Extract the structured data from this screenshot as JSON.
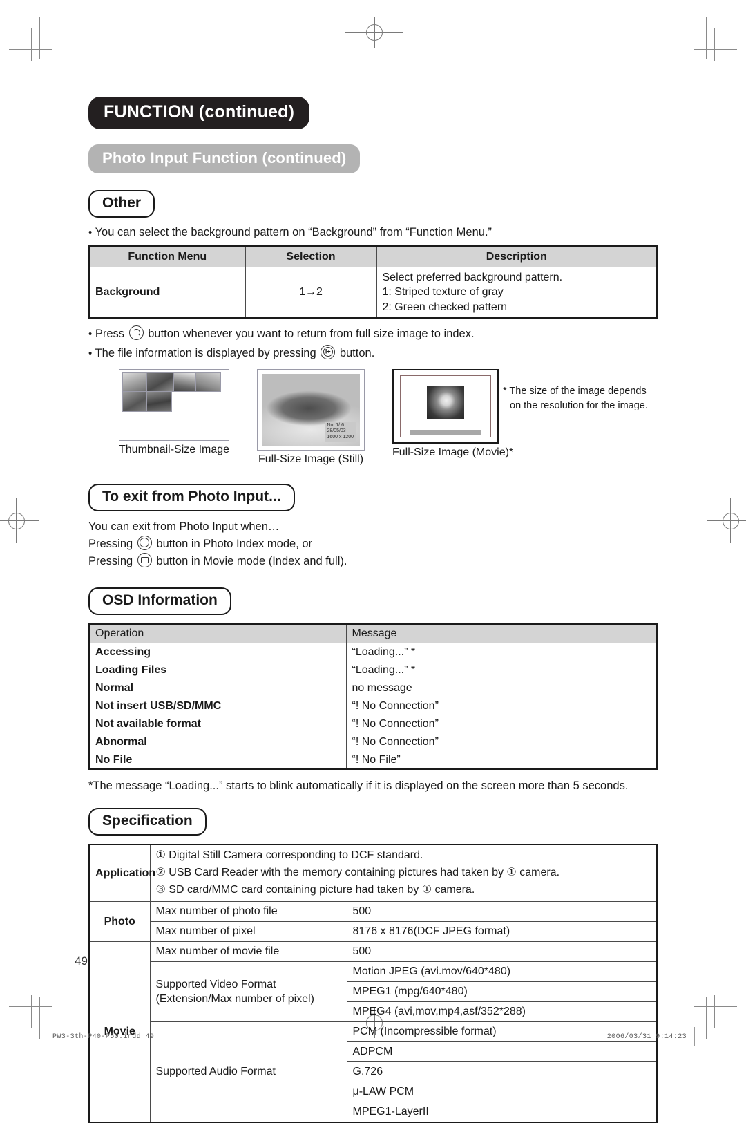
{
  "page": {
    "number": "49",
    "imprint_left": "PW3-3th-P40-P50.indd   49",
    "imprint_right": "2006/03/31   9:14:23"
  },
  "headers": {
    "main": "FUNCTION (continued)",
    "sub": "Photo Input Function (continued)"
  },
  "other": {
    "title": "Other",
    "intro": "You can select the background pattern on “Background” from “Function Menu.”",
    "table": {
      "columns": [
        "Function Menu",
        "Selection",
        "Description"
      ],
      "rows": [
        {
          "menu": "Background",
          "selection": "1→2",
          "description": [
            "Select preferred background pattern.",
            "1: Striped texture of gray",
            "2: Green checked pattern"
          ]
        }
      ]
    },
    "bullets": [
      {
        "pre": "Press",
        "icon": "return-button-icon",
        "icon_label": "",
        "post": "button whenever you want to return from full size image to index."
      },
      {
        "pre": "The file information is displayed by pressing",
        "icon": "info-plus-button-icon",
        "icon_label": "i+",
        "post": "button."
      }
    ]
  },
  "figures": {
    "items": [
      {
        "caption": "Thumbnail-Size Image",
        "kind": "thumbnail-grid"
      },
      {
        "caption": "Full-Size Image (Still)",
        "kind": "full-still"
      },
      {
        "caption": "Full-Size Image (Movie)*",
        "kind": "full-movie"
      }
    ],
    "still_overlay": [
      "No.   1/   6",
      "28/05/03",
      "1600 x 1200"
    ],
    "sidenote": [
      "* The size of the image depends",
      "on the resolution for the image."
    ]
  },
  "exit": {
    "title": "To exit from Photo Input...",
    "lines": [
      {
        "pre": "You can exit from Photo Input when…",
        "icon": "",
        "icon_label": "",
        "post": ""
      },
      {
        "pre": "Pressing",
        "icon": "photo-index-button-icon",
        "icon_label": "",
        "post": "button in Photo Index mode, or"
      },
      {
        "pre": "Pressing",
        "icon": "movie-camera-button-icon",
        "icon_label": "",
        "post": "button in Movie mode (Index and full)."
      }
    ]
  },
  "osd": {
    "title": "OSD Information",
    "columns": [
      "Operation",
      "Message"
    ],
    "rows": [
      {
        "operation": "Accessing",
        "message": "“Loading...” *"
      },
      {
        "operation": "Loading Files",
        "message": "“Loading...” *"
      },
      {
        "operation": "Normal",
        "message": "no message"
      },
      {
        "operation": "Not insert USB/SD/MMC",
        "message": "“! No Connection”"
      },
      {
        "operation": "Not available format",
        "message": "“! No Connection”"
      },
      {
        "operation": "Abnormal",
        "message": "“! No Connection”"
      },
      {
        "operation": "No File",
        "message": "“! No File”"
      }
    ],
    "footnote": "*The message “Loading...” starts to blink automatically if it is displayed on the screen more than 5 seconds."
  },
  "specification": {
    "title": "Specification",
    "application": {
      "label": "Application",
      "items": [
        "① Digital Still Camera corresponding to DCF standard.",
        "② USB Card Reader with the memory containing pictures had taken by ① camera.",
        "③ SD card/MMC card containing picture had taken by ① camera."
      ]
    },
    "photo": {
      "label": "Photo",
      "rows": [
        {
          "name": "Max number of photo file",
          "value": "500"
        },
        {
          "name": "Max number of pixel",
          "value": "8176 x 8176(DCF JPEG format)"
        }
      ]
    },
    "movie": {
      "label": "Movie",
      "file_row": {
        "name": "Max number of movie file",
        "value": "500"
      },
      "video": {
        "name_line1": "Supported Video Format",
        "name_line2": "(Extension/Max number of pixel)",
        "values": [
          "Motion JPEG (avi.mov/640*480)",
          "MPEG1 (mpg/640*480)",
          "MPEG4 (avi,mov,mp4,asf/352*288)"
        ]
      },
      "audio": {
        "name": "Supported Audio Format",
        "values": [
          "PCM (Incompressible format)",
          "ADPCM",
          "G.726",
          "μ-LAW PCM",
          "MPEG1-LayerII"
        ]
      }
    }
  }
}
